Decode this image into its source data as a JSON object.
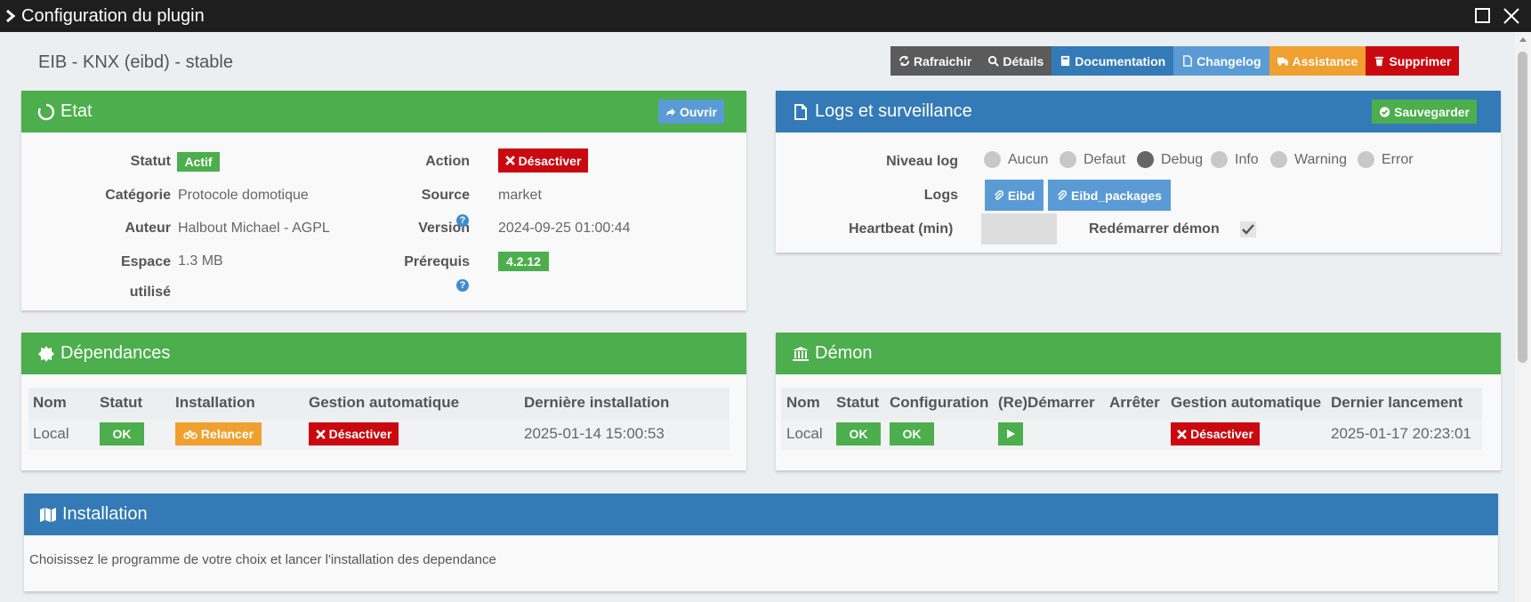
{
  "window": {
    "title": "Configuration du plugin"
  },
  "plugin": {
    "name": "EIB - KNX (eibd) - stable"
  },
  "toolbar": {
    "refresh": "Rafraichir",
    "details": "Détails",
    "documentation": "Documentation",
    "changelog": "Changelog",
    "assistance": "Assistance",
    "delete": "Supprimer"
  },
  "etat": {
    "title": "Etat",
    "open": "Ouvrir",
    "statut_label": "Statut",
    "statut_value": "Actif",
    "categorie_label": "Catégorie",
    "categorie_value": "Protocole domotique",
    "auteur_label": "Auteur",
    "auteur_value": "Halbout Michael",
    "licence_value": " - AGPL",
    "espace_label_1": "Espace",
    "espace_label_2": "utilisé",
    "espace_value": "1.3 MB",
    "action_label": "Action",
    "action_value": "Désactiver",
    "source_label": "Source",
    "source_value": "market",
    "version_label": "Version",
    "version_value": "2024-09-25 01:00:44",
    "prerequis_label": "Prérequis",
    "prerequis_value": "4.2.12",
    "help_glyph": "?"
  },
  "logs": {
    "title": "Logs et surveillance",
    "save": "Sauvegarder",
    "niveau_label": "Niveau log",
    "levels": [
      "Aucun",
      "Defaut",
      "Debug",
      "Info",
      "Warning",
      "Error"
    ],
    "selected_level": "Debug",
    "logs_label": "Logs",
    "log_buttons": [
      "Eibd",
      "Eibd_packages"
    ],
    "heartbeat_label": "Heartbeat (min)",
    "heartbeat_value": "",
    "restart_label": "Redémarrer démon",
    "restart_checked": true
  },
  "dependances": {
    "title": "Dépendances",
    "headers": [
      "Nom",
      "Statut",
      "Installation",
      "Gestion automatique",
      "Dernière installation"
    ],
    "row": {
      "nom": "Local",
      "statut": "OK",
      "installation": "Relancer",
      "gestion": "Désactiver",
      "derniere": "2025-01-14 15:00:53"
    }
  },
  "demon": {
    "title": "Démon",
    "headers": [
      "Nom",
      "Statut",
      "Configuration",
      "(Re)Démarrer",
      "Arrêter",
      "Gestion automatique",
      "Dernier lancement"
    ],
    "row": {
      "nom": "Local",
      "statut": "OK",
      "configuration": "OK",
      "gestion": "Désactiver",
      "dernier": "2025-01-17 20:23:01"
    }
  },
  "installation": {
    "title": "Installation",
    "text": "Choisissez le programme de votre choix et lancer l'installation des dependance"
  },
  "colors": {
    "green": "#4cae4c",
    "blue": "#337ab7",
    "red": "#c9090f",
    "orange": "#f0a030",
    "lightblue": "#5b9bd5",
    "gray": "#5b5b5b"
  }
}
